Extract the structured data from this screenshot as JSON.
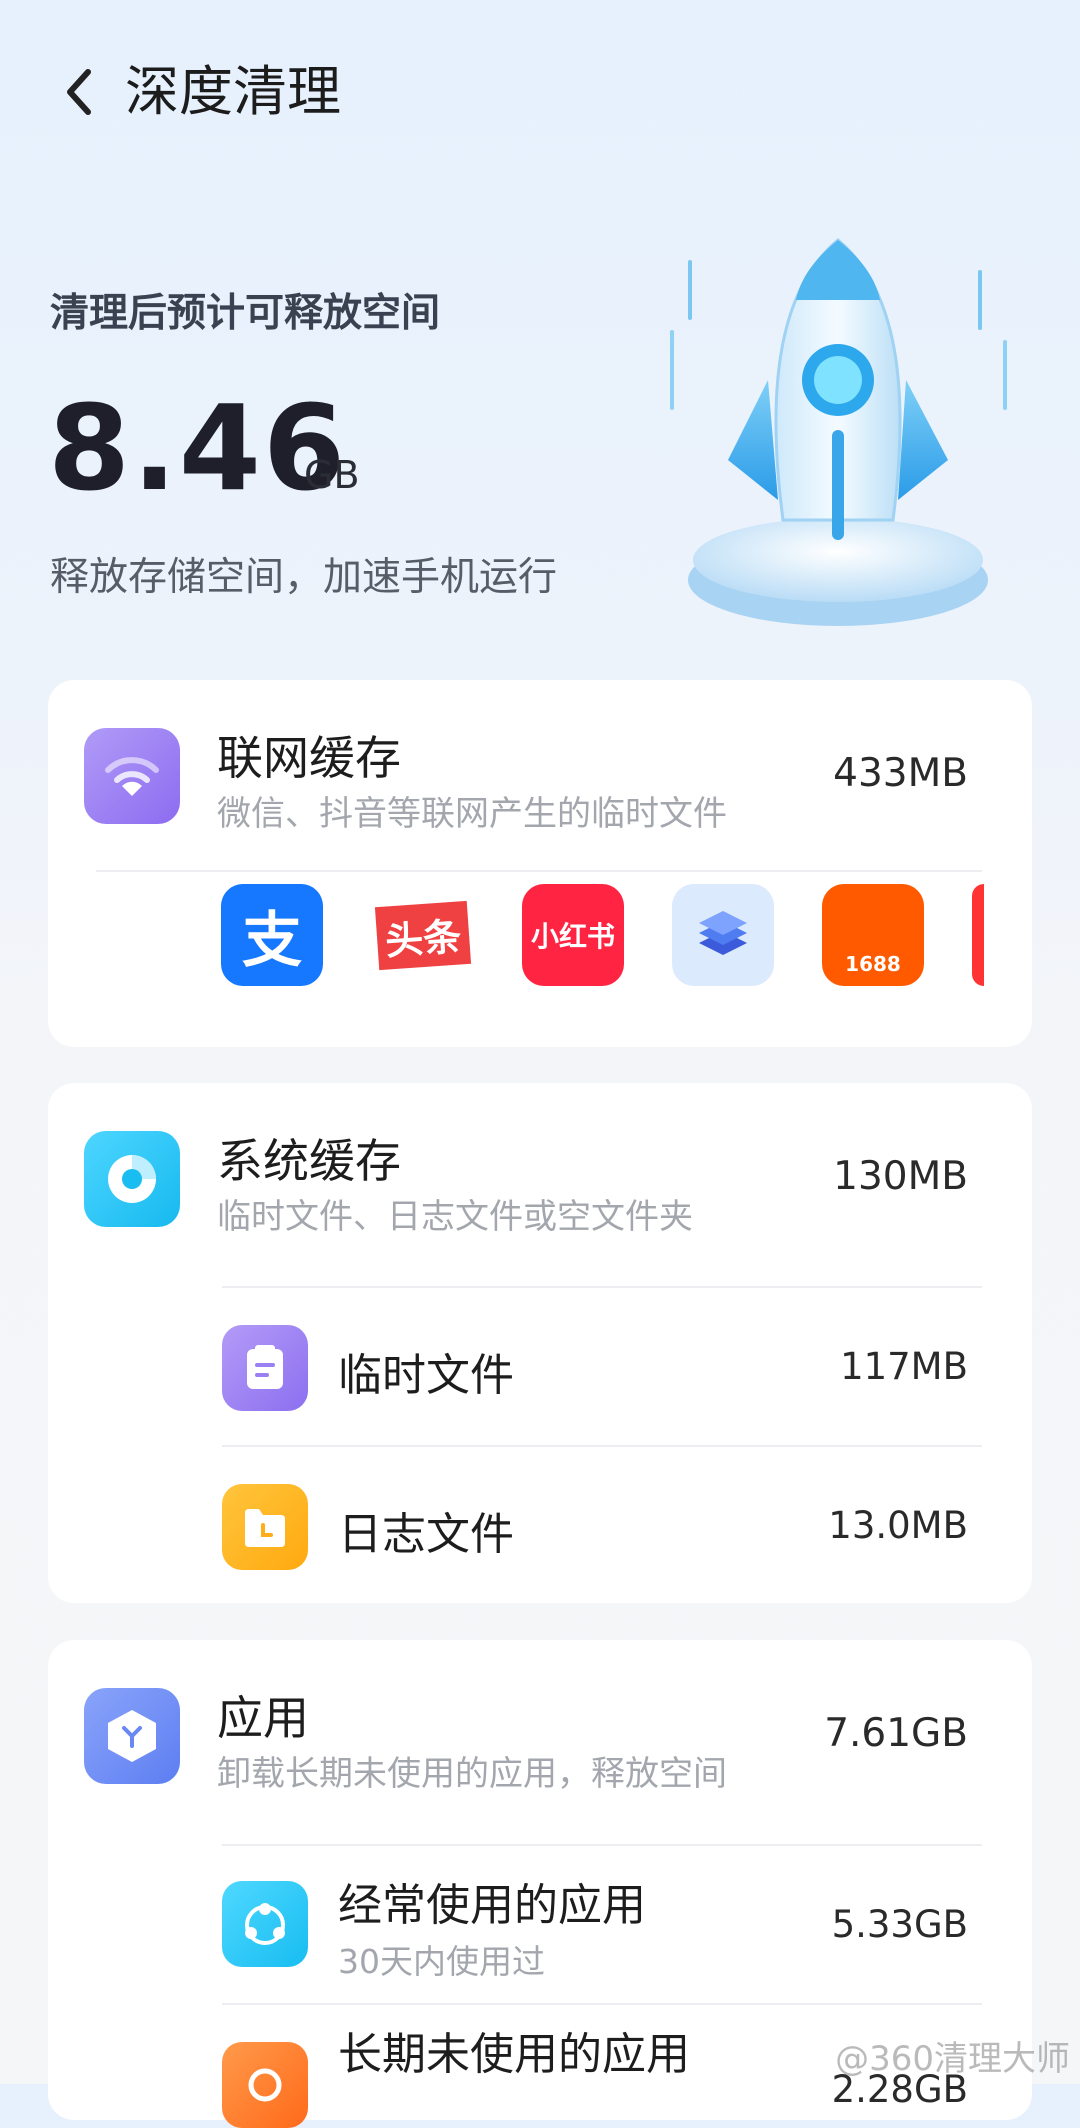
{
  "header": {
    "title": "深度清理"
  },
  "hero": {
    "label": "清理后预计可释放空间",
    "value": "8.46",
    "unit": "GB",
    "subtitle": "释放存储空间，加速手机运行"
  },
  "network_cache": {
    "title": "联网缓存",
    "desc": "微信、抖音等联网产生的临时文件",
    "size": "433MB",
    "apps": [
      {
        "name": "alipay-app-icon",
        "label": "支"
      },
      {
        "name": "toutiao-app-icon",
        "label": "头条"
      },
      {
        "name": "xiaohongshu-app-icon",
        "label": "小红书"
      },
      {
        "name": "layers-app-icon",
        "label": ""
      },
      {
        "name": "app-1688-icon",
        "label": "1688"
      }
    ]
  },
  "system_cache": {
    "title": "系统缓存",
    "desc": "临时文件、日志文件或空文件夹",
    "size": "130MB",
    "items": [
      {
        "title": "临时文件",
        "size": "117MB"
      },
      {
        "title": "日志文件",
        "size": "13.0MB"
      }
    ]
  },
  "apps_section": {
    "title": "应用",
    "desc": "卸载长期未使用的应用，释放空间",
    "size": "7.61GB",
    "items": [
      {
        "title": "经常使用的应用",
        "desc": "30天内使用过",
        "size": "5.33GB"
      },
      {
        "title": "长期未使用的应用",
        "size": "2.28GB"
      }
    ]
  },
  "watermark": "@360清理大师",
  "colors": {
    "accent_purple": "#9b7bf2",
    "accent_cyan": "#1ec4f0",
    "accent_blue": "#6b8cf5",
    "accent_orange": "#ffb21e"
  }
}
